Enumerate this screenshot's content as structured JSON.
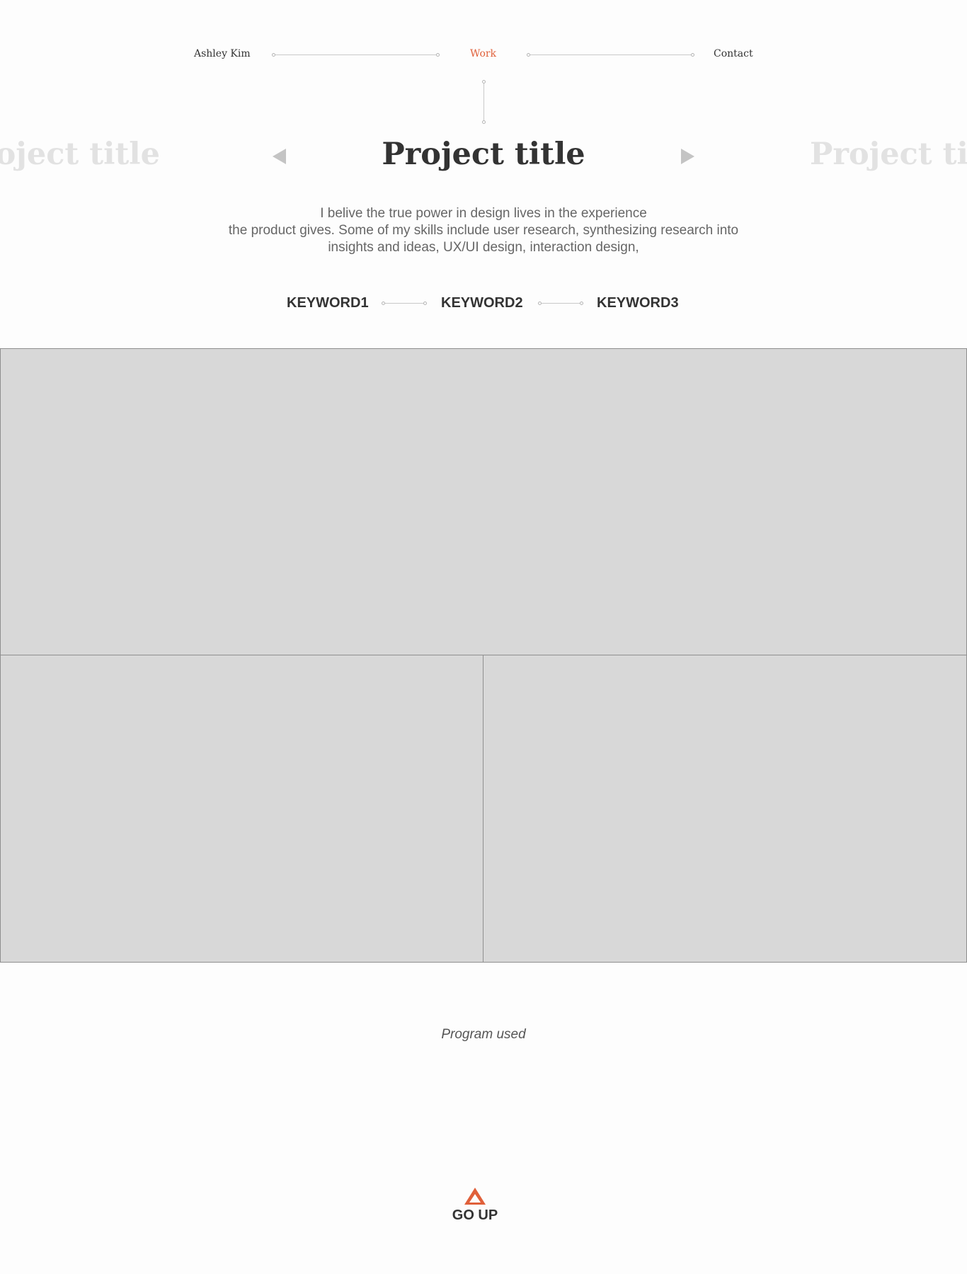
{
  "nav": {
    "name": "Ashley Kim",
    "work": "Work",
    "contact": "Contact"
  },
  "carousel": {
    "previous_title": "Project title",
    "current_title": "Project title",
    "next_title": "Project title"
  },
  "description": {
    "line1": "I belive the true power in design lives in the experience",
    "line2": "the product gives. Some of my skills include user research, synthesizing research into",
    "line3": "insights and ideas, UX/UI design, interaction design,"
  },
  "keywords": [
    "KEYWORD1",
    "KEYWORD2",
    "KEYWORD3"
  ],
  "program_used": "Program used",
  "go_up": {
    "label": "GO UP",
    "icon": "triangle-up-icon"
  },
  "colors": {
    "accent": "#e0603a",
    "text": "#333333",
    "muted_text": "#666666",
    "ghost_text": "#e2e2e2",
    "placeholder_fill": "#d8d8d8",
    "placeholder_border": "#8f8f8f",
    "divider": "#c9c9c9",
    "background": "#fdfdfd"
  }
}
